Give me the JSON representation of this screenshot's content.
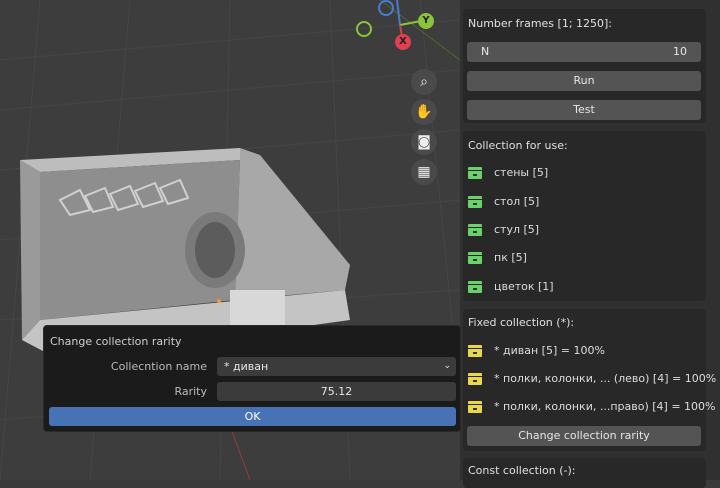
{
  "gizmo": {
    "x": "X",
    "y": "Y"
  },
  "nav_icons": [
    "zoom-icon",
    "hand-pan-icon",
    "camera-icon",
    "grid-perspective-icon"
  ],
  "frames_panel": {
    "label": "Number frames [1; 1250]:",
    "n_label": "N",
    "n_value": "10",
    "run": "Run",
    "test": "Test"
  },
  "use_panel": {
    "label": "Collection for use:",
    "items": [
      "стены [5]",
      "стол [5]",
      "стул [5]",
      "пк [5]",
      "цветок [1]"
    ],
    "color": "#6bd26b"
  },
  "fixed_panel": {
    "label": "Fixed collection (*):",
    "items": [
      "* диван [5] = 100%",
      "* полки, колонки, ... (лево) [4] = 100%",
      "* полки, колонки, ...право) [4] = 100%"
    ],
    "color": "#e8d84a",
    "button": "Change collection rarity"
  },
  "const_panel": {
    "label": "Const collection (-):"
  },
  "dialog": {
    "title": "Change collection rarity",
    "name_label": "Collecntion name",
    "name_value": "* диван",
    "rarity_label": "Rarity",
    "rarity_value": "75.12",
    "ok": "OK"
  }
}
